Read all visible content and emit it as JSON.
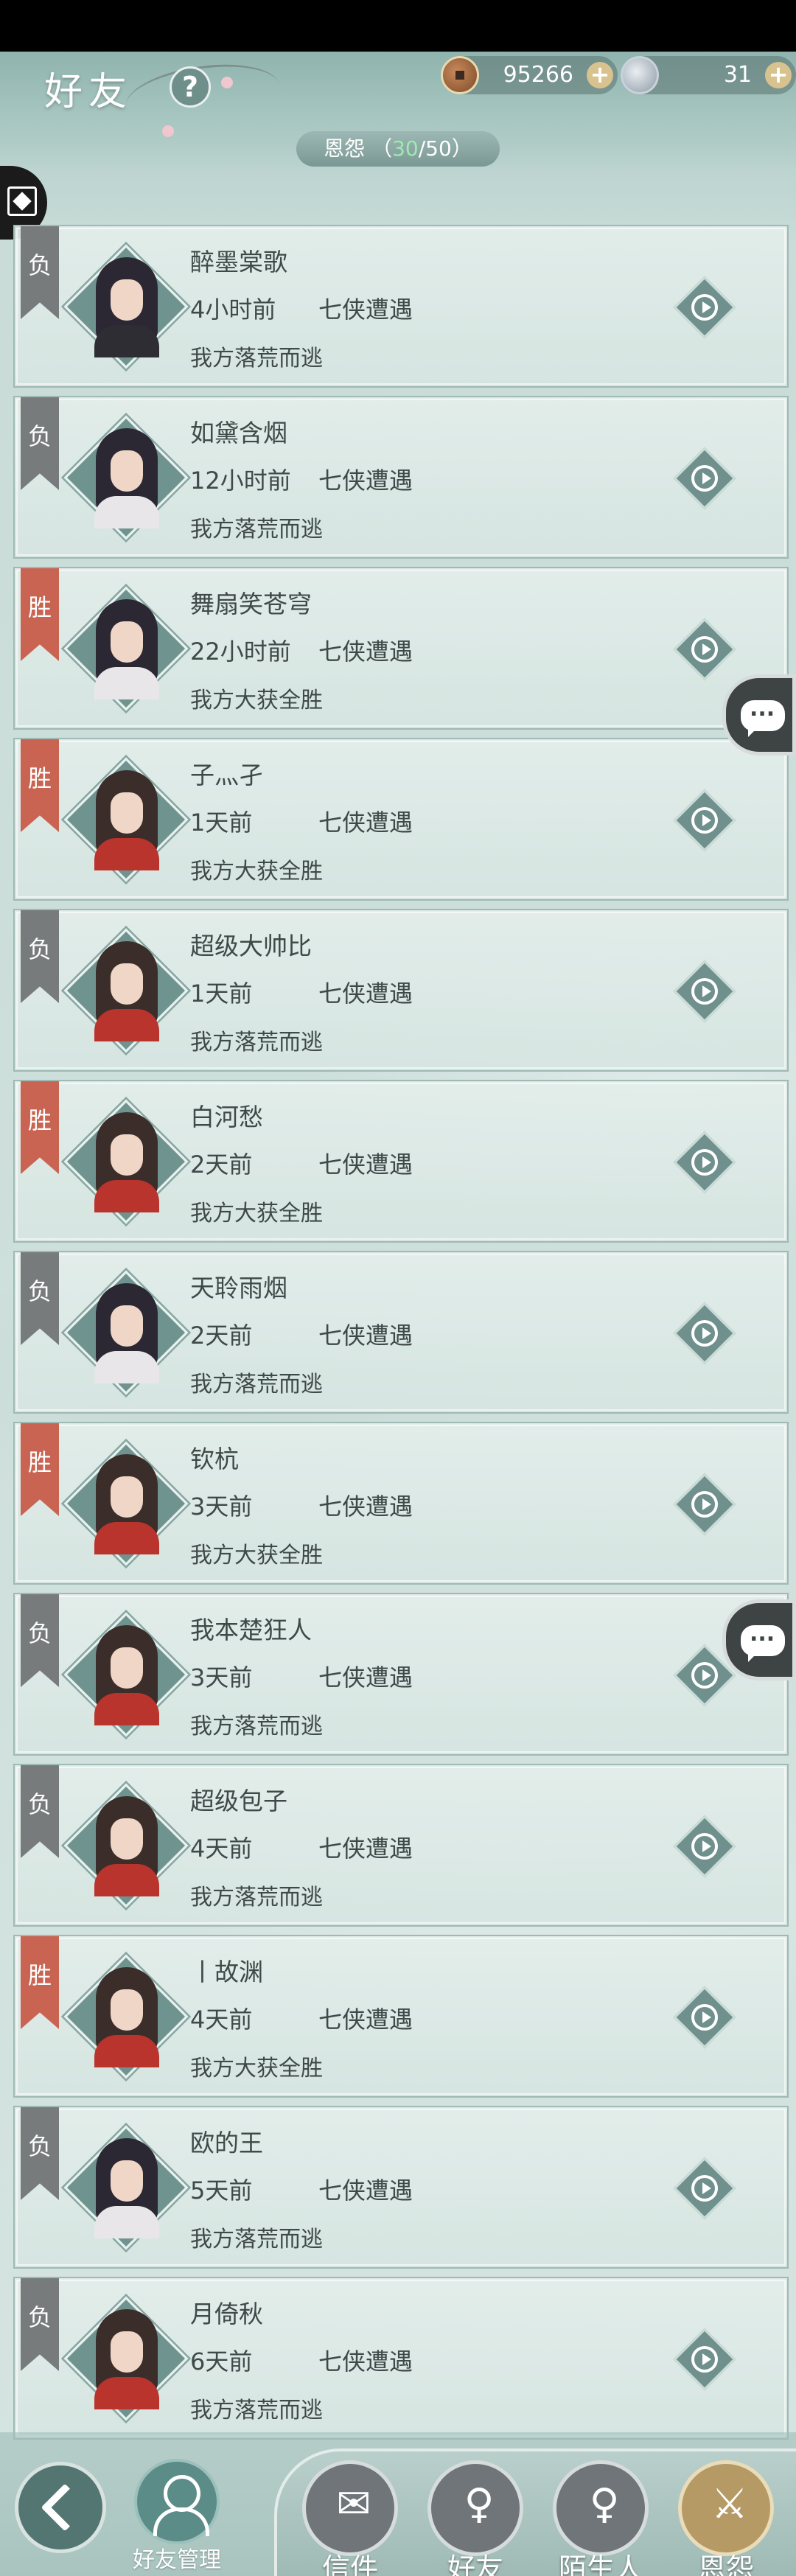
{
  "header": {
    "title": "好友",
    "help_label": "?",
    "copper": "95266",
    "silver": "31",
    "plus_label": "+",
    "tab_label": "恩怨",
    "tab_open": "（",
    "tab_current": "30",
    "tab_total": "/50）"
  },
  "records": [
    {
      "badge": "负",
      "result_type": "lose",
      "name": "醉墨棠歌",
      "time": "4小时前",
      "mode": "七侠遭遇",
      "result": "我方落荒而逃",
      "avatar": "female-black"
    },
    {
      "badge": "负",
      "result_type": "lose",
      "name": "如黛含烟",
      "time": "12小时前",
      "mode": "七侠遭遇",
      "result": "我方落荒而逃",
      "avatar": "female"
    },
    {
      "badge": "胜",
      "result_type": "win",
      "name": "舞扇笑苍穹",
      "time": "22小时前",
      "mode": "七侠遭遇",
      "result": "我方大获全胜",
      "avatar": "female"
    },
    {
      "badge": "胜",
      "result_type": "win",
      "name": "子灬孑",
      "time": "1天前",
      "mode": "七侠遭遇",
      "result": "我方大获全胜",
      "avatar": "male-red"
    },
    {
      "badge": "负",
      "result_type": "lose",
      "name": "超级大帅比",
      "time": "1天前",
      "mode": "七侠遭遇",
      "result": "我方落荒而逃",
      "avatar": "male-red"
    },
    {
      "badge": "胜",
      "result_type": "win",
      "name": "白河愁",
      "time": "2天前",
      "mode": "七侠遭遇",
      "result": "我方大获全胜",
      "avatar": "male-red"
    },
    {
      "badge": "负",
      "result_type": "lose",
      "name": "天聆雨烟",
      "time": "2天前",
      "mode": "七侠遭遇",
      "result": "我方落荒而逃",
      "avatar": "female-white"
    },
    {
      "badge": "胜",
      "result_type": "win",
      "name": "钦杭",
      "time": "3天前",
      "mode": "七侠遭遇",
      "result": "我方大获全胜",
      "avatar": "male-red"
    },
    {
      "badge": "负",
      "result_type": "lose",
      "name": "我本楚狂人",
      "time": "3天前",
      "mode": "七侠遭遇",
      "result": "我方落荒而逃",
      "avatar": "male-red"
    },
    {
      "badge": "负",
      "result_type": "lose",
      "name": "超级包子",
      "time": "4天前",
      "mode": "七侠遭遇",
      "result": "我方落荒而逃",
      "avatar": "male-red"
    },
    {
      "badge": "胜",
      "result_type": "win",
      "name": "丨故渊",
      "time": "4天前",
      "mode": "七侠遭遇",
      "result": "我方大获全胜",
      "avatar": "male-red"
    },
    {
      "badge": "负",
      "result_type": "lose",
      "name": "欧的王",
      "time": "5天前",
      "mode": "七侠遭遇",
      "result": "我方落荒而逃",
      "avatar": "female"
    },
    {
      "badge": "负",
      "result_type": "lose",
      "name": "月倚秋",
      "time": "6天前",
      "mode": "七侠遭遇",
      "result": "我方落荒而逃",
      "avatar": "male-red"
    }
  ],
  "bottom": {
    "manage_label": "好友管理",
    "nav": [
      {
        "label": "信件",
        "glyph": "✉",
        "active": false
      },
      {
        "label": "好友",
        "glyph": "♀",
        "active": false
      },
      {
        "label": "陌生人",
        "glyph": "♀",
        "active": false
      },
      {
        "label": "恩怨",
        "glyph": "⚔",
        "active": true
      }
    ]
  }
}
